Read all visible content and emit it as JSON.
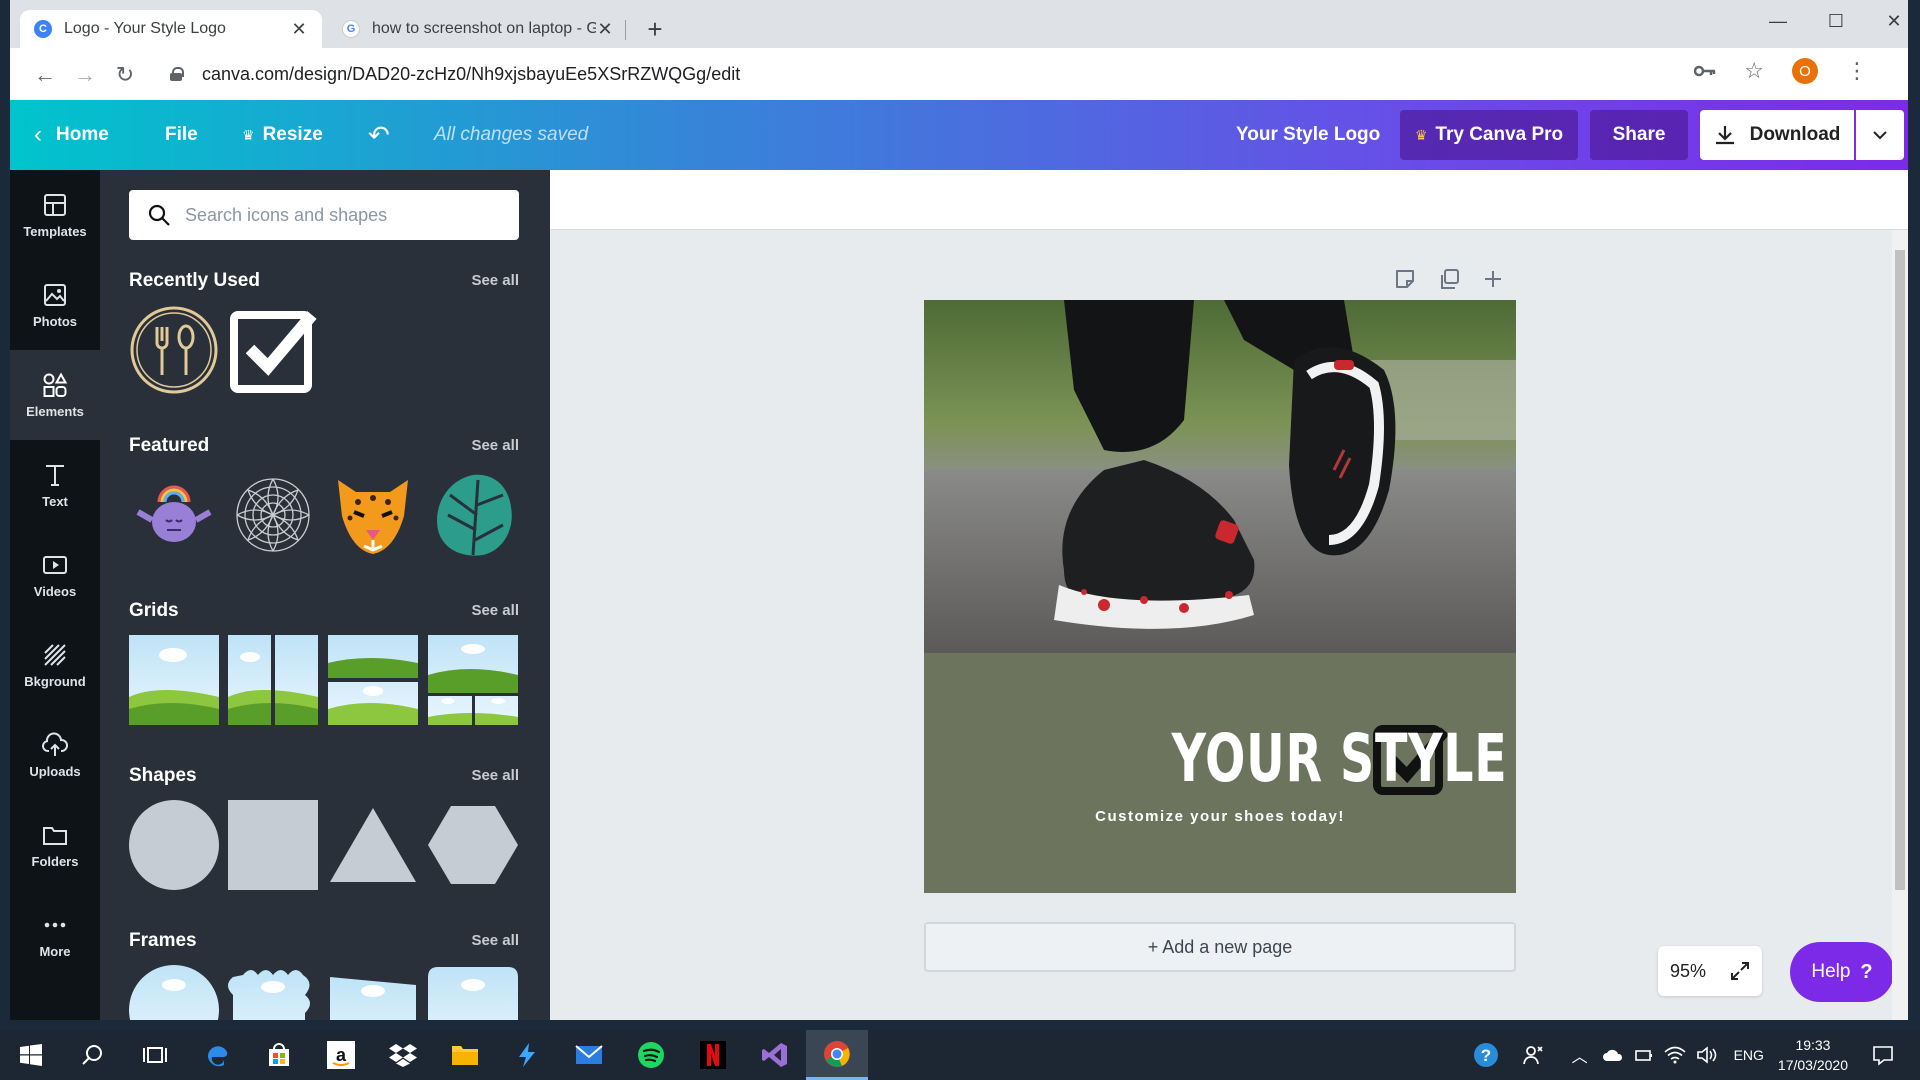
{
  "browser": {
    "tabs": [
      {
        "title": "Logo - Your Style Logo",
        "favicon": "C",
        "active": true
      },
      {
        "title": "how to screenshot on laptop - Go",
        "favicon": "G",
        "active": false
      }
    ],
    "url": "canva.com/design/DAD20-zcHz0/Nh9xjsbayuEe5XSrRZWQGg/edit",
    "profile_initial": "O"
  },
  "canva_top": {
    "home": "Home",
    "file": "File",
    "resize": "Resize",
    "save_status": "All changes saved",
    "design_title": "Your Style Logo",
    "try_pro": "Try Canva Pro",
    "share": "Share",
    "download": "Download"
  },
  "rail": [
    {
      "label": "Templates",
      "icon": "templates-icon"
    },
    {
      "label": "Photos",
      "icon": "photos-icon"
    },
    {
      "label": "Elements",
      "icon": "elements-icon"
    },
    {
      "label": "Text",
      "icon": "text-icon"
    },
    {
      "label": "Videos",
      "icon": "videos-icon"
    },
    {
      "label": "Bkground",
      "icon": "background-icon"
    },
    {
      "label": "Uploads",
      "icon": "uploads-icon"
    },
    {
      "label": "Folders",
      "icon": "folders-icon"
    },
    {
      "label": "More",
      "icon": "more-icon"
    }
  ],
  "panel": {
    "search_placeholder": "Search icons and shapes",
    "see_all": "See all",
    "sections": {
      "recent": "Recently Used",
      "featured": "Featured",
      "grids": "Grids",
      "shapes": "Shapes",
      "frames": "Frames"
    }
  },
  "design": {
    "headline": "YOUR STYLE",
    "subline": "Customize your shoes today!",
    "background_color": "#6c745d"
  },
  "editor": {
    "add_page": "+ Add a new page",
    "zoom": "95%",
    "help": "Help",
    "help_mark": "?"
  },
  "taskbar": {
    "language": "ENG",
    "time": "19:33",
    "date": "17/03/2020"
  },
  "colors": {
    "accent_purple": "#7d2ae8",
    "teal": "#00c4cc",
    "panel_bg": "#293039"
  }
}
